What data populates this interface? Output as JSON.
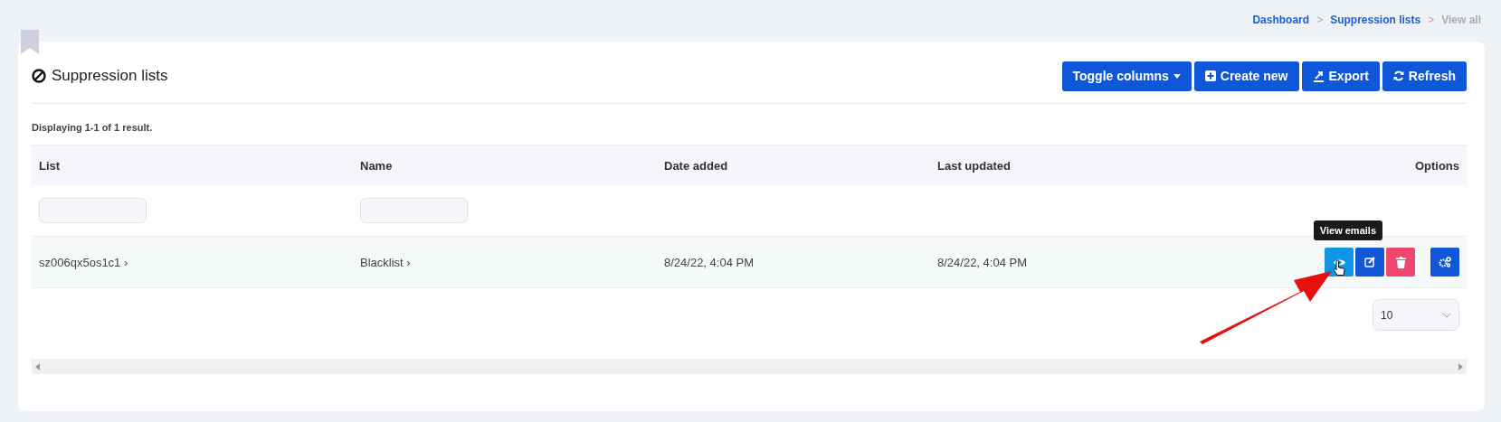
{
  "breadcrumb": [
    {
      "label": "Dashboard",
      "current": false,
      "separator": ">"
    },
    {
      "label": "Suppression lists",
      "current": false,
      "separator": ">"
    },
    {
      "label": "View all",
      "current": true
    }
  ],
  "title": "Suppression lists",
  "toolbar": [
    {
      "label": "Toggle columns",
      "kind": "dropdown"
    },
    {
      "label": "Create new",
      "kind": "create"
    },
    {
      "label": "Export",
      "kind": "export"
    },
    {
      "label": "Refresh",
      "kind": "refresh"
    }
  ],
  "summary": "Displaying 1-1 of 1 result.",
  "table": {
    "columns": [
      {
        "label": "List",
        "filter": true
      },
      {
        "label": "Name",
        "filter": true
      },
      {
        "label": "Date added",
        "filter": false
      },
      {
        "label": "Last updated",
        "filter": false
      },
      {
        "label": "Options",
        "filter": false
      }
    ],
    "rows": [
      {
        "cells": [
          "sz006qx5os1c1 ›",
          "Blacklist ›",
          "8/24/22, 4:04 PM",
          "8/24/22, 4:04 PM"
        ],
        "actions": [
          {
            "kind": "view",
            "hovered": true,
            "tooltip": "View emails"
          },
          {
            "kind": "edit",
            "hovered": false
          },
          {
            "kind": "delete",
            "hovered": false
          },
          {
            "kind": "settings",
            "hovered": false
          }
        ]
      }
    ]
  },
  "per_page": {
    "value": "10"
  }
}
